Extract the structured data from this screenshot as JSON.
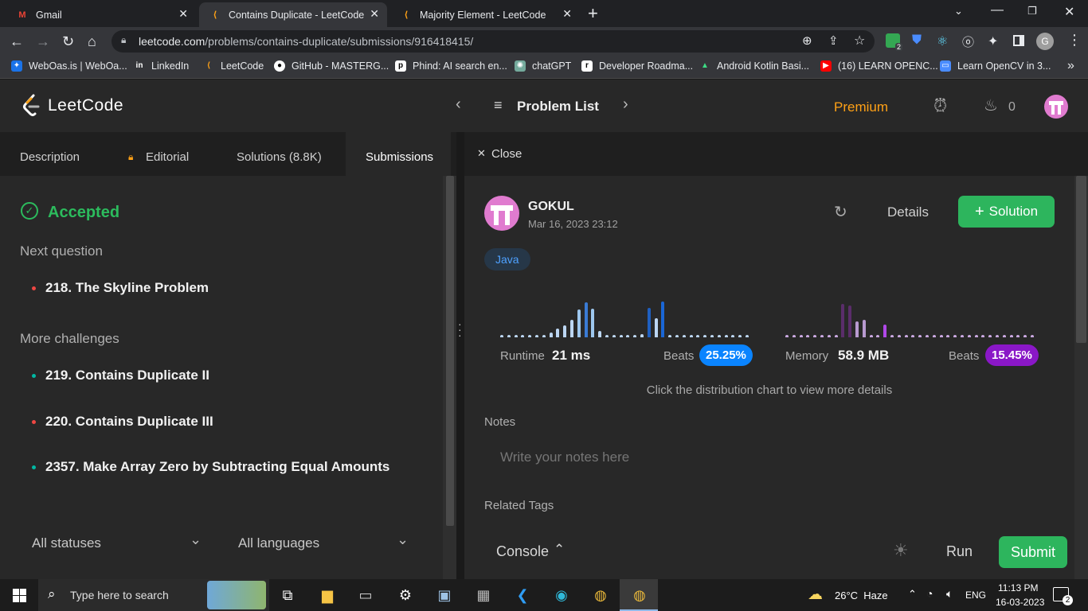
{
  "browser": {
    "tabs": [
      {
        "label": "Gmail",
        "active": false
      },
      {
        "label": "Contains Duplicate - LeetCode",
        "active": true
      },
      {
        "label": "Majority Element - LeetCode",
        "active": false
      }
    ],
    "new_tab": "+",
    "url_host": "leetcode.com",
    "url_path": "/problems/contains-duplicate/submissions/916418415/",
    "extension_badge": "2",
    "profile_letter": "G",
    "bookmarks": [
      "WebOas.is | WebOa...",
      "LinkedIn",
      "LeetCode",
      "GitHub - MASTERG...",
      "Phind: AI search en...",
      "chatGPT",
      "Developer Roadma...",
      "Android Kotlin Basi...",
      "(16) LEARN OPENC...",
      "Learn OpenCV in 3..."
    ],
    "bookmarks_more": "»"
  },
  "header": {
    "logo_text": "LeetCode",
    "problem_list": "Problem List",
    "premium": "Premium",
    "streak_count": "0"
  },
  "left": {
    "tabs": {
      "description": "Description",
      "editorial": "Editorial",
      "solutions": "Solutions (8.8K)",
      "submissions": "Submissions"
    },
    "status": "Accepted",
    "next_question_heading": "Next question",
    "next_questions": [
      {
        "label": "218. The Skyline Problem",
        "dot_color": "#ef4743"
      }
    ],
    "more_challenges_heading": "More challenges",
    "more_challenges": [
      {
        "label": "219. Contains Duplicate II",
        "dot_color": "#00b8a3"
      },
      {
        "label": "220. Contains Duplicate III",
        "dot_color": "#ef4743"
      },
      {
        "label": "2357. Make Array Zero by Subtracting Equal Amounts",
        "dot_color": "#00b8a3"
      }
    ],
    "filter_status": "All statuses",
    "filter_language": "All languages"
  },
  "right": {
    "close_label": "Close",
    "username": "GOKUL",
    "timestamp": "Mar 16, 2023 23:12",
    "details_label": "Details",
    "solution_button": "Solution",
    "language_tag": "Java",
    "runtime": {
      "label": "Runtime",
      "value": "21 ms",
      "beats_label": "Beats",
      "beats_value": "25.25%"
    },
    "memory": {
      "label": "Memory",
      "value": "58.9 MB",
      "beats_label": "Beats",
      "beats_value": "15.45%"
    },
    "hint": "Click the distribution chart to view more details",
    "notes_heading": "Notes",
    "notes_placeholder": "Write your notes here",
    "related_tags_heading": "Related Tags",
    "console_label": "Console",
    "run_label": "Run",
    "submit_label": "Submit"
  },
  "taskbar": {
    "search_placeholder": "Type here to search",
    "weather": "26°C  Haze",
    "lang": "ENG",
    "time": "11:13 PM",
    "date": "16-03-2023",
    "notifications": "2"
  },
  "colors": {
    "accepted": "#2cbb5d",
    "premium": "#ffa116",
    "runtime_badge": "#0a84ff",
    "memory_badge": "#8a17c7",
    "solution_button": "#2db55d"
  }
}
